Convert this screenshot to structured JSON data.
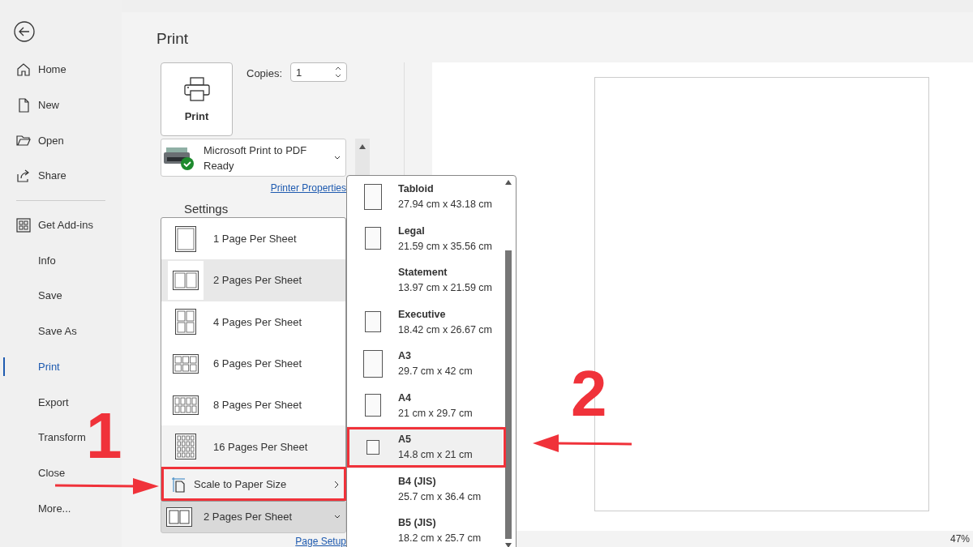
{
  "sidebar": {
    "top_items": [
      {
        "label": "Home",
        "selected": false
      },
      {
        "label": "New",
        "selected": false
      },
      {
        "label": "Open",
        "selected": false
      },
      {
        "label": "Share",
        "selected": false
      }
    ],
    "bottom_items": [
      {
        "label": "Get Add-ins",
        "selected": false
      },
      {
        "label": "Info",
        "selected": false
      },
      {
        "label": "Save",
        "selected": false
      },
      {
        "label": "Save As",
        "selected": false
      },
      {
        "label": "Print",
        "selected": true
      },
      {
        "label": "Export",
        "selected": false
      },
      {
        "label": "Transform",
        "selected": false
      },
      {
        "label": "Close",
        "selected": false
      },
      {
        "label": "More...",
        "selected": false
      }
    ]
  },
  "title": "Print",
  "print_button": {
    "label": "Print"
  },
  "copies": {
    "label": "Copies:",
    "value": "1"
  },
  "printer": {
    "name": "Microsoft Print to PDF",
    "status": "Ready"
  },
  "printer_properties_link": "Printer Properties",
  "settings_heading": "Settings",
  "pages_menu": {
    "items": [
      {
        "label": "1 Page Per Sheet",
        "selected": false,
        "hovered": false
      },
      {
        "label": "2 Pages Per Sheet",
        "selected": true,
        "hovered": false
      },
      {
        "label": "4 Pages Per Sheet",
        "selected": false,
        "hovered": false
      },
      {
        "label": "6 Pages Per Sheet",
        "selected": false,
        "hovered": false
      },
      {
        "label": "8 Pages Per Sheet",
        "selected": false,
        "hovered": false
      },
      {
        "label": "16 Pages Per Sheet",
        "selected": false,
        "hovered": true
      }
    ],
    "submenu": {
      "label": "Scale to Paper Size",
      "expanded": true
    }
  },
  "pages_dropdown": {
    "label": "2 Pages Per Sheet"
  },
  "page_setup_link": "Page Setup",
  "paper_menu": {
    "items": [
      {
        "name": "Tabloid",
        "size": "27.94 cm x 43.18 cm",
        "selected": false
      },
      {
        "name": "Legal",
        "size": "21.59 cm x 35.56 cm",
        "selected": false
      },
      {
        "name": "Statement",
        "size": "13.97 cm x 21.59 cm",
        "selected": false
      },
      {
        "name": "Executive",
        "size": "18.42 cm x 26.67 cm",
        "selected": false
      },
      {
        "name": "A3",
        "size": "29.7 cm x 42 cm",
        "selected": false
      },
      {
        "name": "A4",
        "size": "21 cm x 29.7 cm",
        "selected": false
      },
      {
        "name": "A5",
        "size": "14.8 cm x 21 cm",
        "selected": true
      },
      {
        "name": "B4 (JIS)",
        "size": "25.7 cm x 36.4 cm",
        "selected": false
      },
      {
        "name": "B5 (JIS)",
        "size": "18.2 cm x 25.7 cm",
        "selected": false
      }
    ]
  },
  "zoom": "47%",
  "step_labels": [
    {
      "label": "1"
    },
    {
      "label": "2"
    }
  ]
}
